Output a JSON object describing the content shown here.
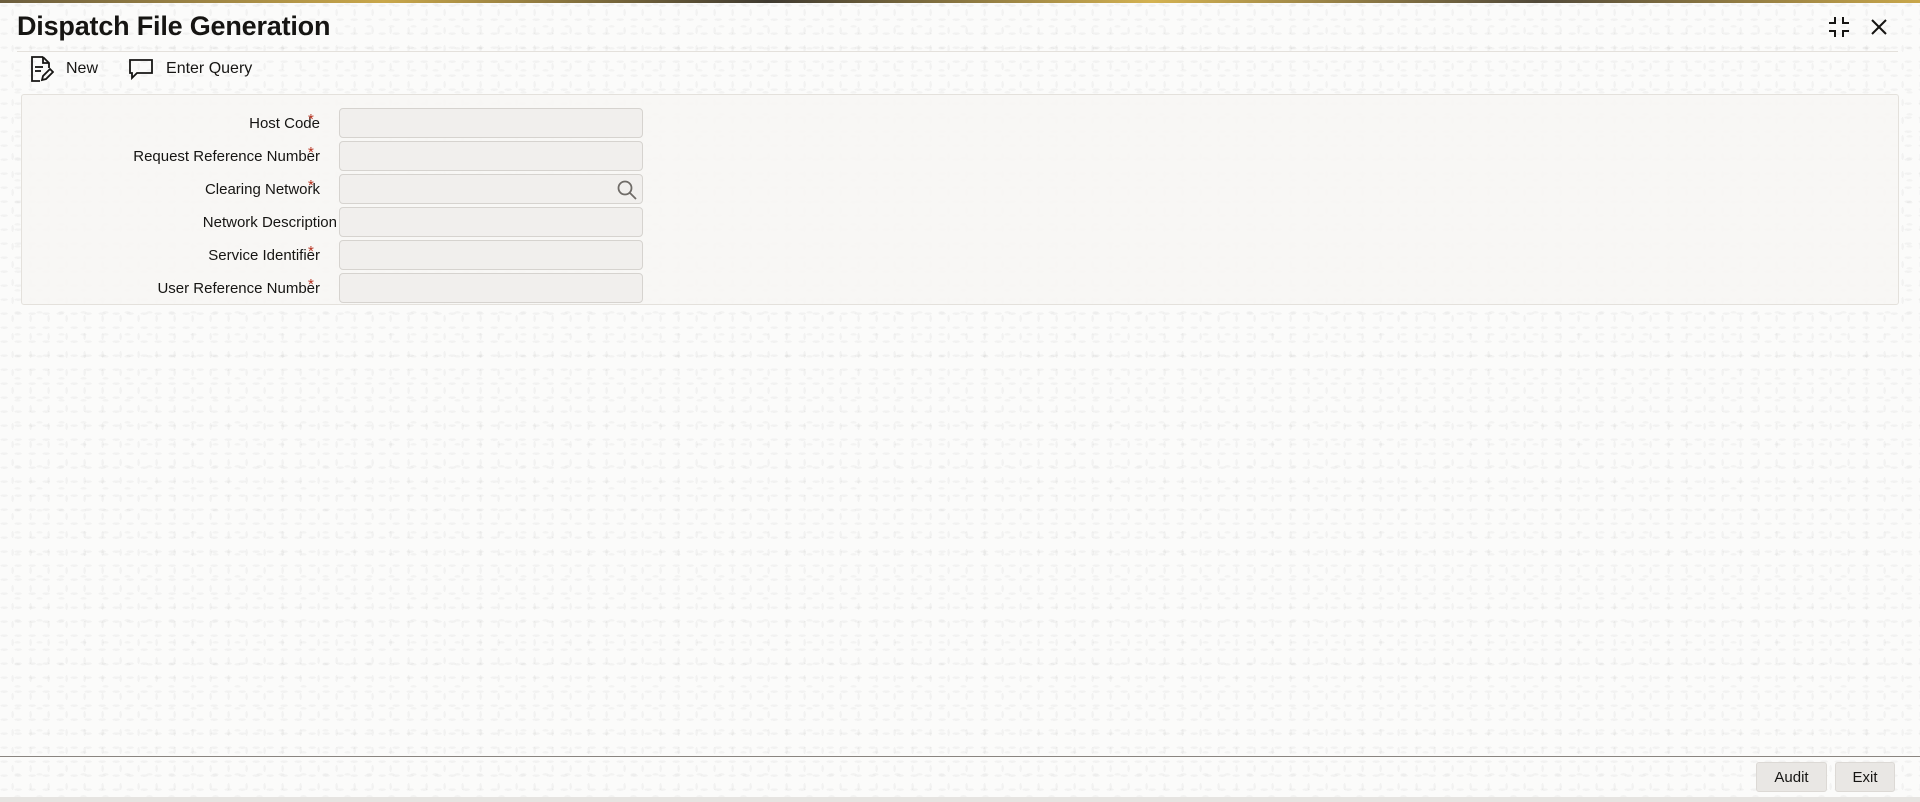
{
  "window": {
    "title": "Dispatch File Generation"
  },
  "toolbar": {
    "new_label": "New",
    "enter_query_label": "Enter Query"
  },
  "form": {
    "fields": [
      {
        "label": "Host Code",
        "required": true,
        "required_mark": "*",
        "value": "",
        "has_lookup": false
      },
      {
        "label": "Request Reference Number",
        "required": true,
        "required_mark": "*",
        "value": "",
        "has_lookup": false
      },
      {
        "label": "Clearing Network",
        "required": true,
        "required_mark": "*",
        "value": "",
        "has_lookup": true
      },
      {
        "label": "Network Description",
        "required": false,
        "required_mark": "",
        "value": "",
        "has_lookup": false
      },
      {
        "label": "Service Identifier",
        "required": true,
        "required_mark": "*",
        "value": "",
        "has_lookup": false
      },
      {
        "label": "User Reference Number",
        "required": true,
        "required_mark": "*",
        "value": "",
        "has_lookup": false
      }
    ]
  },
  "footer": {
    "audit_label": "Audit",
    "exit_label": "Exit"
  },
  "icons": {
    "new": "document-edit-icon",
    "enter_query": "chat-bubble-icon",
    "lookup": "search-icon",
    "minimize": "collapse-icon",
    "close": "close-icon"
  },
  "colors": {
    "required_mark": "#b42f1c",
    "title_text": "#161513"
  }
}
